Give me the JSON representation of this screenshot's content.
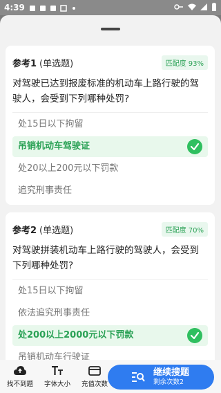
{
  "status_bar": {
    "time": "4:39"
  },
  "cards": [
    {
      "title": "参考1",
      "type": "(单选题)",
      "match": "匹配度 93%",
      "question": "对驾驶已达到报废标准的机动车上路行驶的驾驶人，会受到下列哪种处罚?",
      "options": [
        "处15日以下拘留",
        "吊销机动车驾驶证",
        "处20以上200元以下罚款",
        "追究刑事责任"
      ],
      "correct_index": 1
    },
    {
      "title": "参考2",
      "type": "(单选题)",
      "match": "匹配度 70%",
      "question": "对驾驶拼装机动车上路行驶的驾驶人，会受到下列哪种处罚?",
      "options": [
        "处15日以下拘留",
        "依法追究刑事责任",
        "处200以上2000元以下罚款",
        "吊销机动车行驶证"
      ],
      "correct_index": 2
    }
  ],
  "bottom_bar": {
    "tools": [
      {
        "label": "找不到题",
        "icon": "cloud-upload-icon"
      },
      {
        "label": "字体大小",
        "icon": "font-size-icon"
      },
      {
        "label": "充值次数",
        "icon": "card-icon"
      }
    ],
    "continue": {
      "label": "继续搜题",
      "sub": "剩余次数2"
    }
  },
  "colors": {
    "accent": "#2f7cf0",
    "correct": "#2aa155",
    "correct_bg": "#e8f8ec",
    "badge_bg": "#e9f7ee"
  }
}
